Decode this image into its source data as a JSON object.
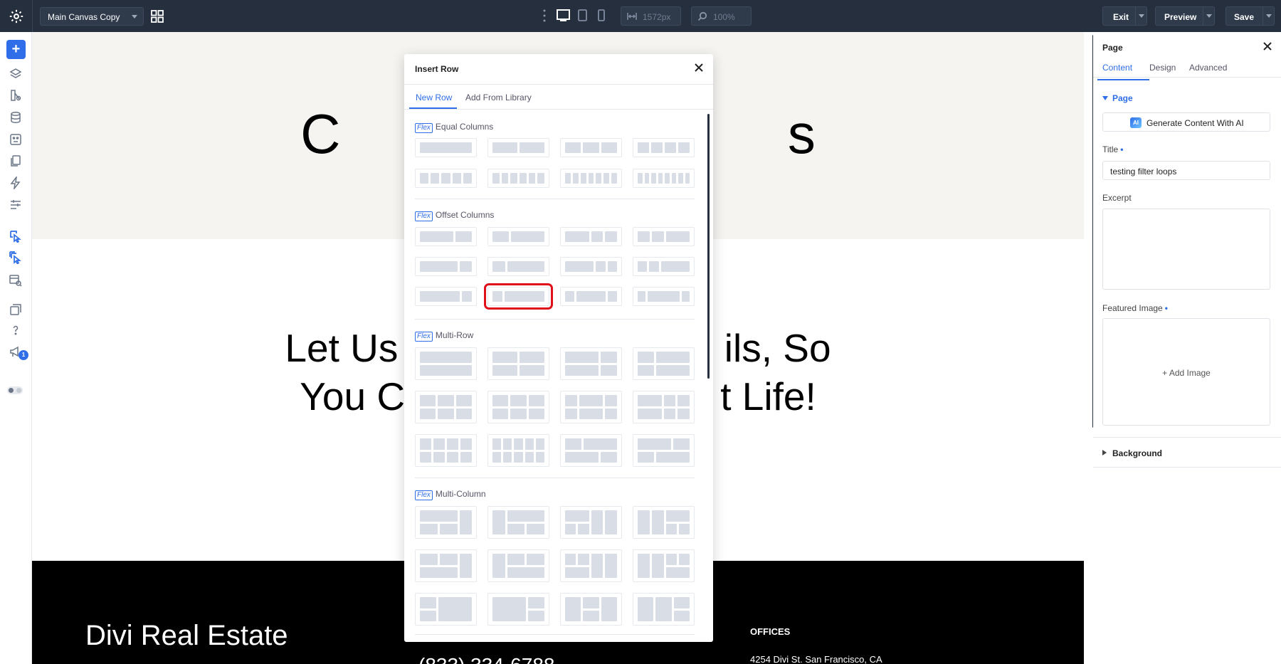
{
  "topbar": {
    "canvas_name": "Main Canvas Copy",
    "width_value": "1572px",
    "zoom_value": "100%",
    "exit_label": "Exit",
    "preview_label": "Preview",
    "save_label": "Save"
  },
  "sidebar": {
    "add_label": "+",
    "notification_count": "1"
  },
  "canvas": {
    "hero_title": "C                             s",
    "tagline_line1": "Let Us                              ils, So",
    "tagline_line2": "You C                             t Life!",
    "footer_brand": "Divi Real Estate",
    "footer_phone": "(833) 334-6788",
    "footer_offices_heading": "OFFICES",
    "footer_address": "4254 Divi St. San Francisco, CA"
  },
  "modal": {
    "title": "Insert Row",
    "tabs": [
      {
        "label": "New Row",
        "active": true
      },
      {
        "label": "Add From Library",
        "active": false
      }
    ],
    "flex_tag": "Flex",
    "groups": [
      {
        "title": "Equal Columns"
      },
      {
        "title": "Offset Columns"
      },
      {
        "title": "Multi-Row"
      },
      {
        "title": "Multi-Column"
      }
    ],
    "selected_layout": "offset-row-3-col-2"
  },
  "panel": {
    "title": "Page",
    "tabs": [
      {
        "label": "Content",
        "active": true
      },
      {
        "label": "Design",
        "active": false
      },
      {
        "label": "Advanced",
        "active": false
      }
    ],
    "section_label": "Page",
    "ai_badge": "AI",
    "ai_button_label": "Generate Content With AI",
    "title_label": "Title",
    "title_value": "testing filter loops",
    "excerpt_label": "Excerpt",
    "featured_image_label": "Featured Image",
    "add_image_label": "+  Add Image",
    "background_label": "Background",
    "required_marker": "•"
  },
  "colors": {
    "topbar_bg": "#262f3d",
    "accent": "#2f6ee8",
    "highlight": "#e0101a",
    "hero_bg": "#f5f4f1",
    "footer_bg": "#000000"
  }
}
